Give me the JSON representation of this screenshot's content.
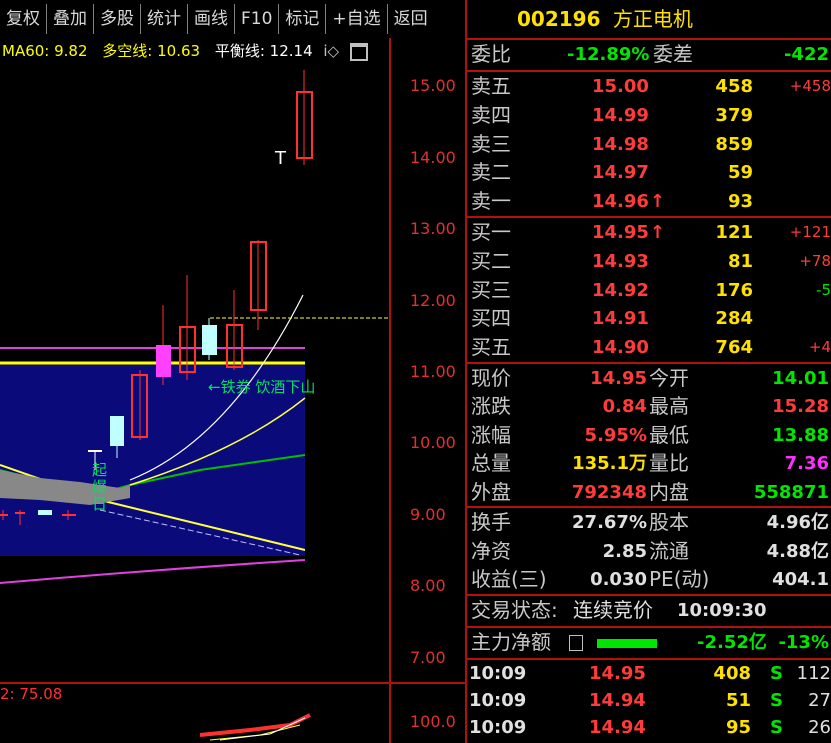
{
  "toolbar": [
    "复权",
    "叠加",
    "多股",
    "统计",
    "画线",
    "F10",
    "标记",
    "+自选",
    "返回"
  ],
  "indicators": {
    "ma60": "MA60: 9.82",
    "duokong": "多空线: 10.63",
    "pingheng": "平衡线: 12.14",
    "icons": "i◇",
    "window_icon": "window-icon"
  },
  "price_axis": [
    "15.00",
    "14.00",
    "13.00",
    "12.00",
    "11.00",
    "10.00",
    "9.00",
    "8.00",
    "7.00"
  ],
  "annotations": {
    "note": "←铁券 饮酒下山",
    "vertical": "起\n爆\n日",
    "t1": "T",
    "t2": "T"
  },
  "sub_chart": {
    "label": "2: 75.08",
    "tick": "100.0"
  },
  "stock": {
    "code": "002196",
    "name": "方正电机"
  },
  "order_book": {
    "weibi_label": "委比",
    "weibi": "-12.89%",
    "weicha_label": "委差",
    "weicha": "-422",
    "sells": [
      {
        "label": "卖五",
        "price": "15.00",
        "vol": "458",
        "change": "+458",
        "arrow": ""
      },
      {
        "label": "卖四",
        "price": "14.99",
        "vol": "379",
        "change": "",
        "arrow": ""
      },
      {
        "label": "卖三",
        "price": "14.98",
        "vol": "859",
        "change": "",
        "arrow": ""
      },
      {
        "label": "卖二",
        "price": "14.97",
        "vol": "59",
        "change": "",
        "arrow": ""
      },
      {
        "label": "卖一",
        "price": "14.96",
        "vol": "93",
        "change": "",
        "arrow": "↑"
      }
    ],
    "buys": [
      {
        "label": "买一",
        "price": "14.95",
        "vol": "121",
        "change": "+121",
        "arrow": "↑"
      },
      {
        "label": "买二",
        "price": "14.93",
        "vol": "81",
        "change": "+78",
        "arrow": ""
      },
      {
        "label": "买三",
        "price": "14.92",
        "vol": "176",
        "change": "-5",
        "arrow": ""
      },
      {
        "label": "买四",
        "price": "14.91",
        "vol": "284",
        "change": "",
        "arrow": ""
      },
      {
        "label": "买五",
        "price": "14.90",
        "vol": "764",
        "change": "+4",
        "arrow": ""
      }
    ]
  },
  "quote": [
    {
      "l1": "现价",
      "v1": "14.95",
      "c1": "red",
      "l2": "今开",
      "v2": "14.01",
      "c2": "green"
    },
    {
      "l1": "涨跌",
      "v1": "0.84",
      "c1": "red",
      "l2": "最高",
      "v2": "15.28",
      "c2": "red"
    },
    {
      "l1": "涨幅",
      "v1": "5.95%",
      "c1": "red",
      "l2": "最低",
      "v2": "13.88",
      "c2": "green"
    },
    {
      "l1": "总量",
      "v1": "135.1万",
      "c1": "yellow",
      "l2": "量比",
      "v2": "7.36",
      "c2": "purple"
    },
    {
      "l1": "外盘",
      "v1": "792348",
      "c1": "red",
      "l2": "内盘",
      "v2": "558871",
      "c2": "green"
    }
  ],
  "fundamentals": [
    {
      "l1": "换手",
      "v1": "27.67%",
      "l2": "股本",
      "v2": "4.96亿"
    },
    {
      "l1": "净资",
      "v1": "2.85",
      "l2": "流通",
      "v2": "4.88亿"
    },
    {
      "l1": "收益(三)",
      "v1": "0.030",
      "l2": "PE(动)",
      "v2": "404.1"
    }
  ],
  "status": {
    "label": "交易状态:",
    "value": "连续竞价",
    "time": "10:09:30"
  },
  "main_force": {
    "label": "主力净额",
    "value": "-2.52亿",
    "pct": "-13%"
  },
  "ticks": [
    {
      "time": "10:09",
      "price": "14.95",
      "vol": "408",
      "side": "S",
      "num": "112"
    },
    {
      "time": "10:09",
      "price": "14.94",
      "vol": "51",
      "side": "S",
      "num": "27"
    },
    {
      "time": "10:09",
      "price": "14.94",
      "vol": "95",
      "side": "S",
      "num": "26"
    }
  ]
}
